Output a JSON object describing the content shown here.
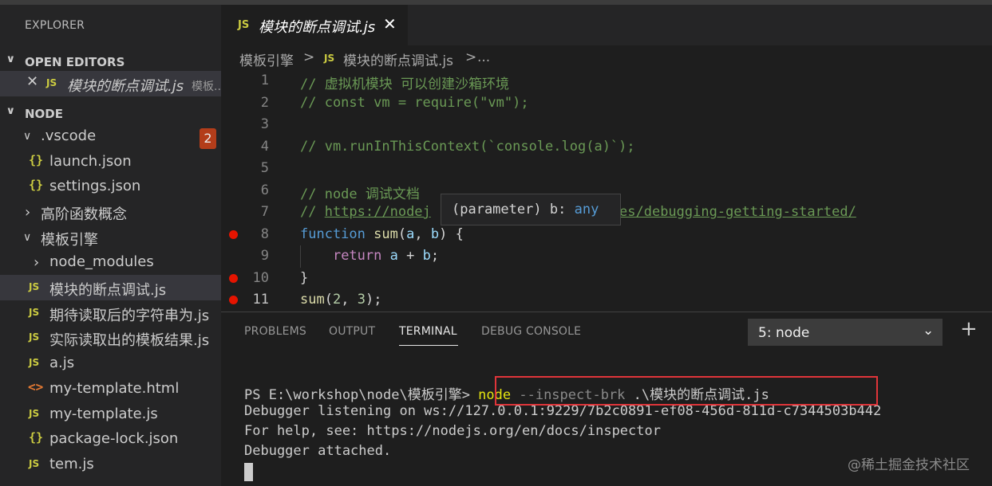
{
  "sidebar": {
    "title": "EXPLORER",
    "open_editors_label": "OPEN EDITORS",
    "open_editor_item": {
      "name": "模块的断点调试.js",
      "folder": "模板..."
    },
    "node_label": "NODE",
    "items": [
      {
        "label": ".vscode",
        "kind": "folder-open",
        "badge": "2"
      },
      {
        "label": "launch.json",
        "kind": "json"
      },
      {
        "label": "settings.json",
        "kind": "json"
      },
      {
        "label": "高阶函数概念",
        "kind": "folder-closed"
      },
      {
        "label": "模板引擎",
        "kind": "folder-open"
      },
      {
        "label": "node_modules",
        "kind": "folder-closed"
      },
      {
        "label": "模块的断点调试.js",
        "kind": "js",
        "selected": true
      },
      {
        "label": "期待读取后的字符串为.js",
        "kind": "js"
      },
      {
        "label": "实际读取出的模板结果.js",
        "kind": "js"
      },
      {
        "label": "a.js",
        "kind": "js"
      },
      {
        "label": "my-template.html",
        "kind": "html"
      },
      {
        "label": "my-template.js",
        "kind": "js"
      },
      {
        "label": "package-lock.json",
        "kind": "json"
      },
      {
        "label": "tem.js",
        "kind": "js"
      }
    ]
  },
  "icons": {
    "js": "JS",
    "json": "{}",
    "html": "<>",
    "chev_down": "⌄",
    "chev_right": "›",
    "close": "✕",
    "plus": "+"
  },
  "tab": {
    "label": "模块的断点调试.js"
  },
  "breadcrumb": {
    "folder": "模板引擎",
    "sep": ">",
    "file": "模块的断点调试.js",
    "more": "..."
  },
  "editor": {
    "line_numbers": [
      "1",
      "2",
      "3",
      "4",
      "5",
      "6",
      "7",
      "8",
      "9",
      "10",
      "11"
    ],
    "breakpoint_lines": [
      "8",
      "10",
      "11"
    ],
    "hover": {
      "kind": "(parameter)",
      "name": "b",
      "colon": ":",
      "type": "any"
    },
    "lines": {
      "l1": "// 虚拟机模块 可以创建沙箱环境",
      "l2": "// const vm = require(\"vm\");",
      "l4": "// vm.runInThisContext(`console.log(a)`);",
      "l6": "// node 调试文档",
      "l7_prefix": "// ",
      "l7_link_a": "https://nodej",
      "l7_link_b": "des/debugging-getting-started/",
      "l8": {
        "kw": "function",
        "fn": "sum",
        "open": "(",
        "p1": "a",
        "comma": ", ",
        "p2": "b",
        "close": ") {"
      },
      "l9": {
        "kw": "return",
        "p1": "a",
        "op": " + ",
        "p2": "b",
        "end": ";"
      },
      "l10": "}",
      "l11": {
        "fn": "sum",
        "open": "(",
        "n1": "2",
        "comma": ", ",
        "n2": "3",
        "close": ");"
      }
    }
  },
  "panel": {
    "tabs": [
      "PROBLEMS",
      "OUTPUT",
      "TERMINAL",
      "DEBUG CONSOLE"
    ],
    "active_tab": "TERMINAL",
    "select_value": "5: node",
    "terminal": {
      "prompt": "PS E:\\workshop\\node\\模板引擎> ",
      "cmd_node": "node",
      "cmd_flag": " --inspect-brk",
      "cmd_arg": " .\\模块的断点调试.js",
      "line2": "Debugger listening on ws://127.0.0.1:9229/7b2c0891-ef08-456d-811d-c7344503b442",
      "line3": "For help, see: https://nodejs.org/en/docs/inspector",
      "line4": "Debugger attached."
    }
  },
  "watermark": "@稀土掘金技术社区"
}
